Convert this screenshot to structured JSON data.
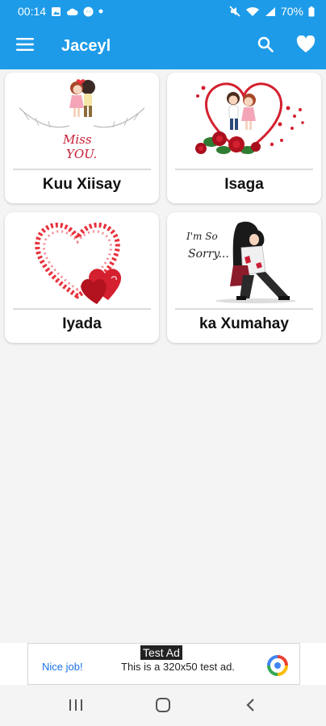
{
  "status_bar": {
    "time": "00:14",
    "battery": "70%",
    "left_icons": [
      "image-icon",
      "cloud-icon",
      "messenger-icon",
      "dot-icon"
    ],
    "right_icons": [
      "mute-icon",
      "wifi-icon",
      "signal-icon",
      "battery-icon"
    ]
  },
  "app_bar": {
    "title": "Jaceyl",
    "color": "#1e9be8",
    "icons": [
      "menu-icon",
      "search-icon",
      "heart-icon"
    ]
  },
  "categories": [
    {
      "label": "Kuu Xiisay",
      "image": "miss-you-couple-illustration"
    },
    {
      "label": "Isaga",
      "image": "couple-in-heart-with-roses-illustration"
    },
    {
      "label": "Iyada",
      "image": "heart-of-hearts-illustration"
    },
    {
      "label": "ka Xumahay",
      "image": "im-so-sorry-couple-illustration"
    }
  ],
  "ad": {
    "tag": "Test Ad",
    "nice": "Nice job!",
    "text": "This is a 320x50 test ad.",
    "icon": "ad-logo-icon"
  },
  "nav_bar": {
    "icons": [
      "recents-icon",
      "home-icon",
      "back-icon"
    ]
  }
}
